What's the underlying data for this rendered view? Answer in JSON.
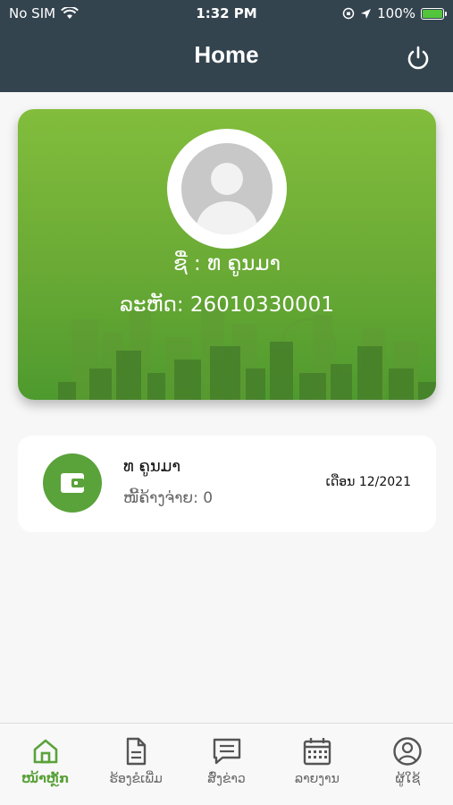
{
  "status_bar": {
    "carrier": "No SIM",
    "time": "1:32 PM",
    "battery": "100%"
  },
  "header": {
    "title": "Home",
    "power_icon": "power-icon"
  },
  "profile": {
    "name_line": "ຊື່ : ທ ຄູນມາ",
    "code_line": "ລະຫັດ: 26010330001",
    "avatar_icon": "person-placeholder-icon"
  },
  "debt_card": {
    "name": "ທ ຄູນມາ",
    "owed": "ໜີ້ຄ້າງຈ່າຍ: 0",
    "month": "ເດືອນ 12/2021",
    "icon": "wallet-icon"
  },
  "tabs": [
    {
      "label": "ໜ້າຫຼັກ",
      "icon": "home-icon",
      "active": true
    },
    {
      "label": "ຮ້ອງຂໍເພີ່ມ",
      "icon": "document-icon",
      "active": false
    },
    {
      "label": "ສົ່ງຂ່າວ",
      "icon": "message-icon",
      "active": false
    },
    {
      "label": "ລາຍງານ",
      "icon": "calendar-icon",
      "active": false
    },
    {
      "label": "ຜູ້ໃຊ້",
      "icon": "user-icon",
      "active": false
    }
  ],
  "colors": {
    "header_bg": "#34444f",
    "accent_green": "#5aa23a",
    "card_green": "#6aaa35"
  }
}
